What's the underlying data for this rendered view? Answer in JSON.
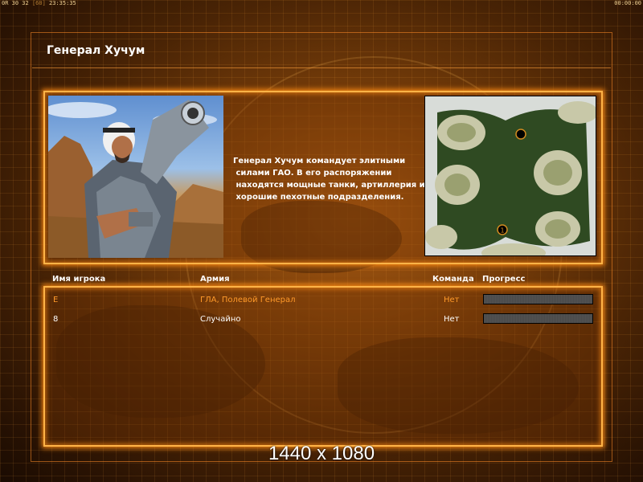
{
  "topbar": {
    "left_prefix": "0R",
    "left_nums": "30 32",
    "left_fps": "[60]",
    "left_time": "23:35:35",
    "right_time": "00:00:00"
  },
  "title": "Генерал Хучум",
  "description": "Генерал Хучум командует элитными\n силами ГАО. В его распоряжении\n находятся мощные танки, артиллерия и\n хорошие пехотные подразделения.",
  "table": {
    "headers": {
      "player": "Имя игрока",
      "army": "Армия",
      "team": "Команда",
      "progress": "Прогресс"
    },
    "rows": [
      {
        "player": "E",
        "army": "ГЛА, Полевой Генерал",
        "team": "Нет",
        "progress": 0.0
      },
      {
        "player": "8",
        "army": "Случайно",
        "team": "Нет",
        "progress": 0.0
      }
    ]
  },
  "minimap": {
    "start_positions": [
      "1",
      "2"
    ]
  },
  "resolution_overlay": "1440 x 1080",
  "colors": {
    "accent": "#ffb347",
    "highlight_text": "#ff9a2a",
    "text": "#ffffff"
  }
}
